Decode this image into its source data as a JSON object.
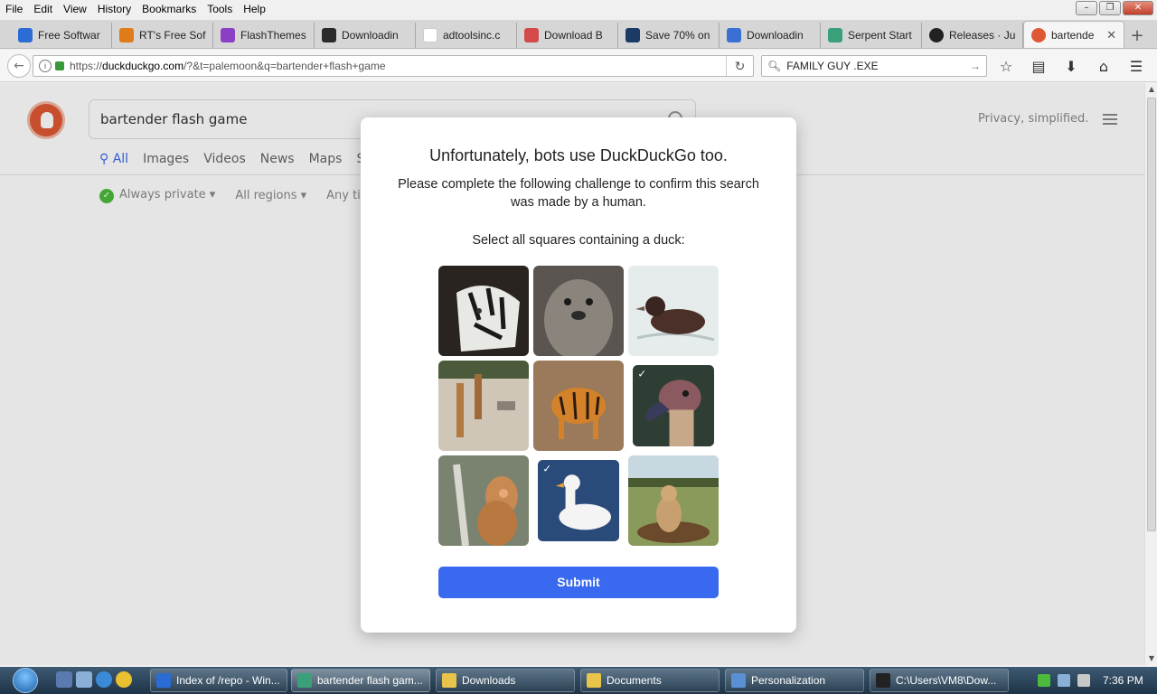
{
  "menubar": {
    "items": [
      "File",
      "Edit",
      "View",
      "History",
      "Bookmarks",
      "Tools",
      "Help"
    ]
  },
  "tabs": [
    {
      "label": "Free Softwar",
      "color": "#2b6cd4"
    },
    {
      "label": "RT's Free Sof",
      "color": "#e07b1a"
    },
    {
      "label": "FlashThemes",
      "color": "#8a3fc4"
    },
    {
      "label": "Downloadin",
      "color": "#2a2a2a"
    },
    {
      "label": "adtoolsinc.c",
      "color": "#ffffff"
    },
    {
      "label": "Download B",
      "color": "#d44a4a"
    },
    {
      "label": "Save 70% on",
      "color": "#1b3a66"
    },
    {
      "label": "Downloadin",
      "color": "#3a6fd4"
    },
    {
      "label": "Serpent Start",
      "color": "#3aa07a"
    },
    {
      "label": "Releases · Ju",
      "color": "#222222"
    },
    {
      "label": "bartende",
      "color": "#de5833",
      "active": true
    }
  ],
  "navbar": {
    "url_prefix": "https://",
    "url_host": "duckduckgo.com",
    "url_path": "/?&t=palemoon&q=bartender+flash+game",
    "search_value": "FAMILY GUY .EXE"
  },
  "ddg": {
    "query": "bartender flash game",
    "tabs": [
      "All",
      "Images",
      "Videos",
      "News",
      "Maps",
      "Sh"
    ],
    "filters": [
      "Always private ▾",
      "All regions ▾",
      "Any ti"
    ],
    "privacy": "Privacy, simplified."
  },
  "modal": {
    "title": "Unfortunately, bots use DuckDuckGo too.",
    "subtitle": "Please complete the following challenge to confirm this search was made by a human.",
    "prompt": "Select all squares containing a duck:",
    "submit": "Submit",
    "cells": [
      {
        "icon": "tiger-image",
        "selected": false
      },
      {
        "icon": "seal-image",
        "selected": false
      },
      {
        "icon": "duck-on-water-image",
        "selected": false
      },
      {
        "icon": "giraffes-image",
        "selected": false
      },
      {
        "icon": "tiger-walking-image",
        "selected": false
      },
      {
        "icon": "duck-head-image",
        "selected": true
      },
      {
        "icon": "monkey-image",
        "selected": false
      },
      {
        "icon": "white-duck-image",
        "selected": true
      },
      {
        "icon": "lioness-image",
        "selected": false
      }
    ],
    "accent": "#3969ef"
  },
  "taskbar": {
    "items": [
      {
        "label": "Index of /repo - Win...",
        "color": "#2b6cd4"
      },
      {
        "label": "bartender flash gam...",
        "color": "#3aa07a",
        "active": true
      },
      {
        "label": "Downloads",
        "color": "#e8c44a"
      },
      {
        "label": "Documents",
        "color": "#e8c44a"
      },
      {
        "label": "Personalization",
        "color": "#5a8fd4"
      },
      {
        "label": "C:\\Users\\VM8\\Dow...",
        "color": "#222222"
      }
    ],
    "clock": "7:36 PM"
  }
}
